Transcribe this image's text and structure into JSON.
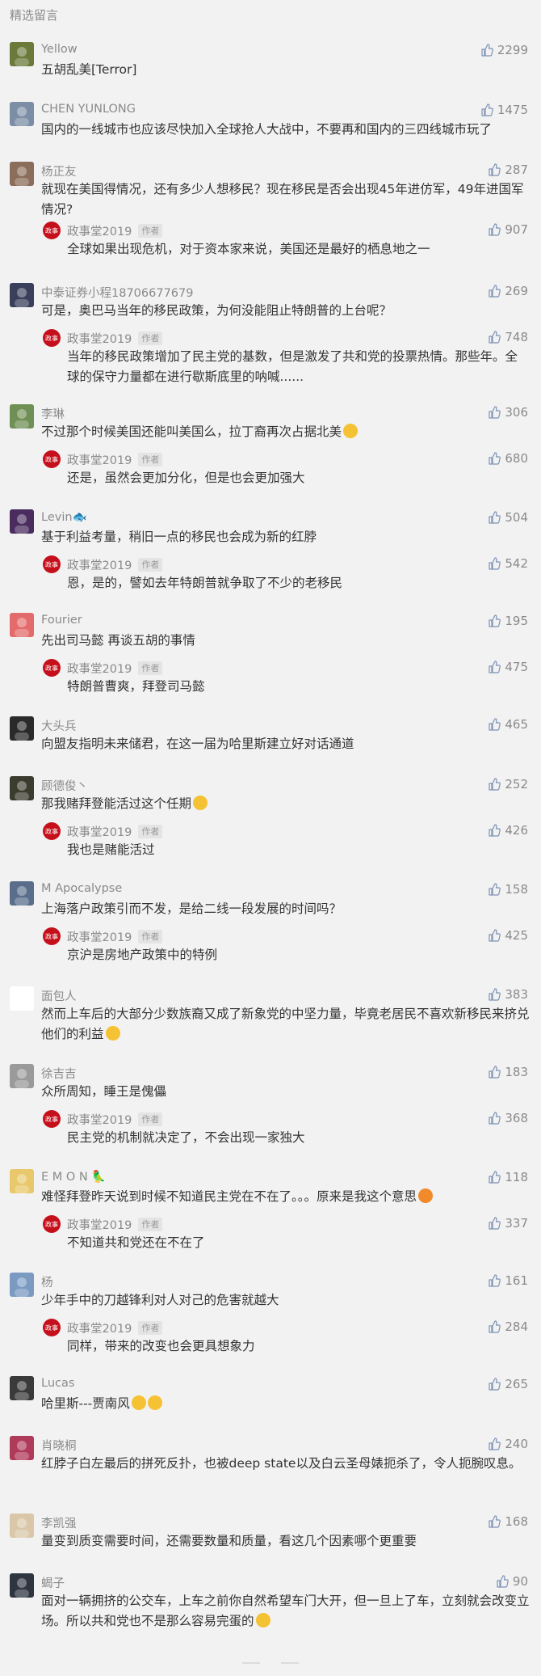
{
  "section_title": "精选留言",
  "author_tag": "作者",
  "comments": [
    {
      "name": "Yellow",
      "likes": "2299",
      "text": "五胡乱美[Terror]",
      "avatar_color": "#6b7a3a"
    },
    {
      "name": "CHEN YUNLONG",
      "likes": "1475",
      "text": "国内的一线城市也应该尽快加入全球抢人大战中，不要再和国内的三四线城市玩了",
      "avatar_color": "#7b8ea6"
    },
    {
      "name": "杨正友",
      "likes": "287",
      "text": "就现在美国得情况，还有多少人想移民？现在移民是否会出现45年进仿军，49年进国军情况?",
      "avatar_color": "#8a6d5a",
      "reply": {
        "name": "政事堂2019",
        "likes": "907",
        "text": "全球如果出现危机，对于资本家来说，美国还是最好的栖息地之一"
      }
    },
    {
      "name": "中泰证券小程18706677679",
      "likes": "269",
      "text": "可是，奥巴马当年的移民政策，为何没能阻止特朗普的上台呢？",
      "avatar_color": "#3a3f5c",
      "reply": {
        "name": "政事堂2019",
        "likes": "748",
        "text": "当年的移民政策增加了民主党的基数，但是激发了共和党的投票热情。那些年。全球的保守力量都在进行歇斯底里的呐喊......"
      }
    },
    {
      "name": "李琳",
      "likes": "306",
      "text": "不过那个时候美国还能叫美国么，拉丁裔再次占据北美",
      "avatar_color": "#6f8f55",
      "emoji": true,
      "reply": {
        "name": "政事堂2019",
        "likes": "680",
        "text": "还是，虽然会更加分化，但是也会更加强大"
      }
    },
    {
      "name": "Levin🐟",
      "likes": "504",
      "text": "基于利益考量，稍旧一点的移民也会成为新的红脖",
      "avatar_color": "#4a2c5e",
      "reply": {
        "name": "政事堂2019",
        "likes": "542",
        "text": "恩，是的，譬如去年特朗普就争取了不少的老移民"
      }
    },
    {
      "name": "Fourier",
      "likes": "195",
      "text": "先出司马懿 再谈五胡的事情",
      "avatar_color": "#e46b6b",
      "reply": {
        "name": "政事堂2019",
        "likes": "475",
        "text": "特朗普曹爽，拜登司马懿"
      }
    },
    {
      "name": "大头兵",
      "likes": "465",
      "text": "向盟友指明未来储君，在这一届为哈里斯建立好对话通道",
      "avatar_color": "#2a2a2a"
    },
    {
      "name": "顾德俊丶",
      "likes": "252",
      "text": "那我赌拜登能活过这个任期",
      "avatar_color": "#3b3b2e",
      "emoji": true,
      "reply": {
        "name": "政事堂2019",
        "likes": "426",
        "text": "我也是赌能活过"
      }
    },
    {
      "name": "M Apocalypse",
      "likes": "158",
      "text": "上海落户政策引而不发，是给二线一段发展的时间吗？",
      "avatar_color": "#5a6e8c",
      "reply": {
        "name": "政事堂2019",
        "likes": "425",
        "text": "京沪是房地产政策中的特例"
      }
    },
    {
      "name": "面包人",
      "likes": "383",
      "text": "然而上车后的大部分少数族裔又成了新象党的中坚力量，毕竟老居民不喜欢新移民来挤兑他们的利益",
      "avatar_color": "#ffffff",
      "emoji": true
    },
    {
      "name": "徐吉吉",
      "likes": "183",
      "text": "众所周知，睡王是傀儡",
      "avatar_color": "#9a9a9a",
      "reply": {
        "name": "政事堂2019",
        "likes": "368",
        "text": "民主党的机制就决定了，不会出现一家独大"
      }
    },
    {
      "name": "E M O N 🦜",
      "likes": "118",
      "text": "难怪拜登昨天说到时候不知道民主党在不在了。。。原来是我这个意思",
      "avatar_color": "#e8c86a",
      "emoji_red": true,
      "reply": {
        "name": "政事堂2019",
        "likes": "337",
        "text": "不知道共和党还在不在了"
      }
    },
    {
      "name": "杨",
      "likes": "161",
      "text": "少年手中的刀越锋利对人对己的危害就越大",
      "avatar_color": "#7a9ac2",
      "reply": {
        "name": "政事堂2019",
        "likes": "284",
        "text": "同样，带来的改变也会更具想象力"
      }
    },
    {
      "name": "Lucas",
      "likes": "265",
      "text": "哈里斯---贾南风",
      "avatar_color": "#3a3a3a",
      "emoji_double": true
    },
    {
      "name": "肖晓桐",
      "likes": "240",
      "text": "红脖子白左最后的拼死反扑，也被deep  state以及白云圣母婊扼杀了，令人扼腕叹息。",
      "avatar_color": "#b03a5a"
    },
    {
      "name": "李凯强",
      "likes": "168",
      "text": "量变到质变需要时间，还需要数量和质量，看这几个因素哪个更重要",
      "avatar_color": "#d9c7a8"
    },
    {
      "name": "蝎子",
      "likes": "90",
      "text": "面对一辆拥挤的公交车，上车之前你自然希望车门大开，但一旦上了车，立刻就会改变立场。所以共和党也不是那么容易完蛋的",
      "avatar_color": "#2e3440",
      "emoji": true
    }
  ]
}
